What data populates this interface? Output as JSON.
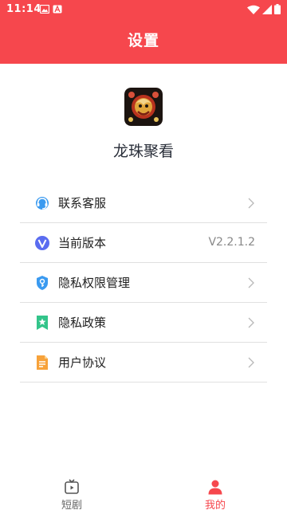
{
  "status": {
    "time": "11:14"
  },
  "header": {
    "title": "设置"
  },
  "app": {
    "name": "龙珠聚看"
  },
  "settings": {
    "items": [
      {
        "label": "联系客服",
        "icon": "headset-icon"
      },
      {
        "label": "当前版本",
        "icon": "version-icon",
        "value": "V2.2.1.2"
      },
      {
        "label": "隐私权限管理",
        "icon": "shield-key-icon"
      },
      {
        "label": "隐私政策",
        "icon": "bookmark-star-icon"
      },
      {
        "label": "用户协议",
        "icon": "document-icon"
      }
    ]
  },
  "tabs": [
    {
      "label": "短剧",
      "icon": "tv-icon",
      "active": false
    },
    {
      "label": "我的",
      "icon": "person-icon",
      "active": true
    }
  ],
  "colors": {
    "accent": "#F6474D",
    "divider": "#e0e0e0",
    "inactive_tab": "#666666"
  }
}
